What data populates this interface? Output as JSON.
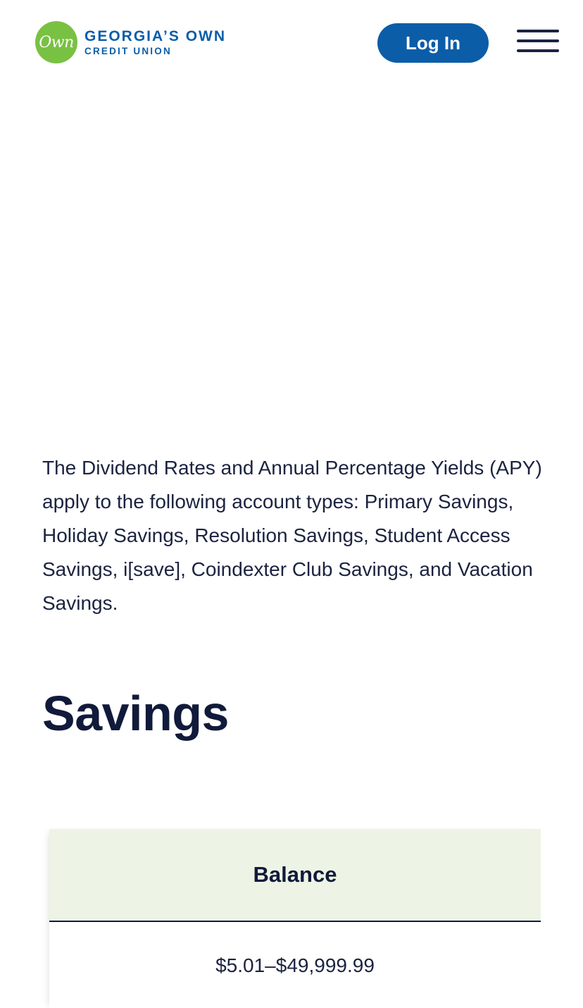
{
  "header": {
    "logo_mark": "Own",
    "logo_line1": "GEORGIA’S OWN",
    "logo_line2": "CREDIT UNION",
    "login_label": "Log In",
    "menu_icon": "hamburger-menu-icon"
  },
  "main": {
    "intro": "The Dividend Rates and Annual Percentage Yields (APY) apply to the following account types: Primary Savings, Holiday Savings, Resolution Savings, Student Access Savings, i[save], Coindexter Club Savings, and Vacation Savings.",
    "section_title": "Savings",
    "table": {
      "columns": [
        "Balance"
      ],
      "rows": [
        [
          "$5.01–$49,999.99"
        ]
      ]
    }
  },
  "colors": {
    "brand_blue": "#0b5da8",
    "brand_green": "#79c143",
    "table_header_bg": "#edf4e5",
    "text_dark": "#111a3a"
  }
}
